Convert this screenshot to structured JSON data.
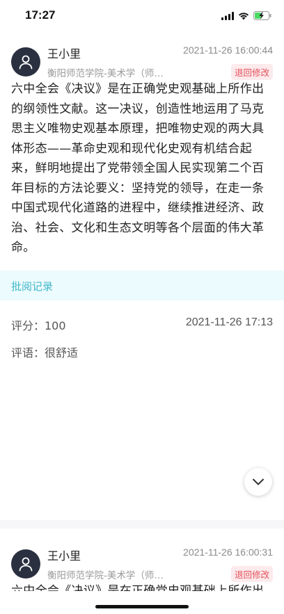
{
  "status_bar": {
    "time": "17:27",
    "icons": [
      "signal-icon",
      "wifi-icon",
      "battery-charging-icon"
    ],
    "battery_color": "#4cd964"
  },
  "posts": [
    {
      "author": "王小里",
      "school": "衡阳师范学院-美术学（师…",
      "timestamp": "2021-11-26 16:00:44",
      "status": "退回修改",
      "content": "六中全会《决议》是在正确党史观基础上所作出的纲领性文献。这一决议，创造性地运用了马克思主义唯物史观基本原理，把唯物史观的两大具体形态——革命史观和现代化史观有机结合起来，鲜明地提出了党带领全国人民实现第二个百年目标的方法论要义：坚持党的领导，在走一条中国式现代化道路的进程中，继续推进经济、政治、社会、文化和生态文明等各个层面的伟大革命。"
    },
    {
      "author": "王小里",
      "school": "衡阳师范学院-美术学（师…",
      "timestamp": "2021-11-26 16:00:31",
      "status": "退回修改",
      "content": "六中全会《决议》是在正确党史观基础上所作出"
    }
  ],
  "review": {
    "header": "批阅记录",
    "score_label": "评分：100",
    "date": "2021-11-26 17:13",
    "comment": "评语：很舒适"
  },
  "colors": {
    "accent": "#3fb6c9",
    "status_red": "#e3525b",
    "review_bg": "#ecfbfd"
  }
}
